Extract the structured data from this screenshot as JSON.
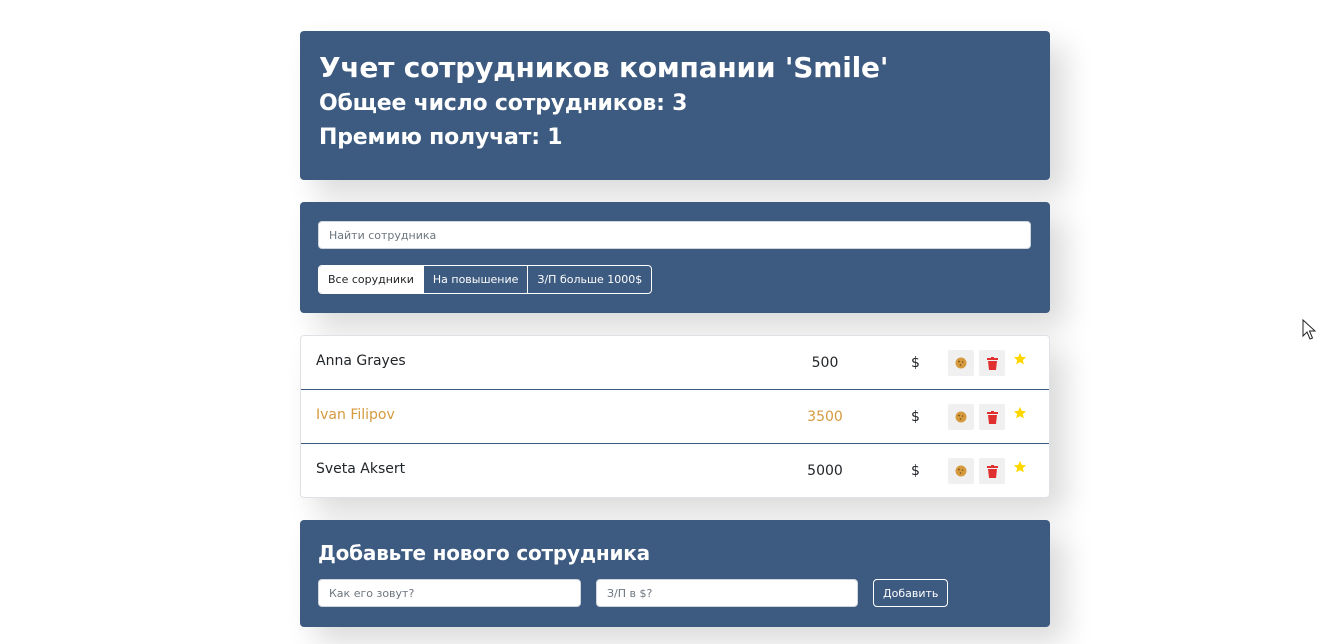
{
  "header": {
    "title": "Учет сотрудников компании 'Smile'",
    "total": "Общее число сотрудников: 3",
    "bonus": "Премию получат: 1"
  },
  "search": {
    "placeholder": "Найти сотрудника",
    "filters": [
      {
        "label": "Все сорудники",
        "active": true
      },
      {
        "label": "На повышение",
        "active": false
      },
      {
        "label": "З/П больше 1000$",
        "active": false
      }
    ]
  },
  "employees": [
    {
      "name": "Anna Grayes",
      "salary": "500",
      "currency": "$",
      "increase": false
    },
    {
      "name": "Ivan Filipov",
      "salary": "3500",
      "currency": "$",
      "increase": true
    },
    {
      "name": "Sveta Aksert",
      "salary": "5000",
      "currency": "$",
      "increase": false
    }
  ],
  "add_form": {
    "title": "Добавьте нового сотрудника",
    "name_placeholder": "Как его зовут?",
    "salary_placeholder": "З/П в $?",
    "submit_label": "Добавить"
  },
  "icons": {
    "cookie": "cookie-icon",
    "trash": "trash-icon",
    "star": "star-icon"
  },
  "colors": {
    "panel": "#3d5a80",
    "increase": "#d59a3d",
    "cookie": "#d59a3d",
    "trash": "#e0302f",
    "star": "#ffd700"
  }
}
